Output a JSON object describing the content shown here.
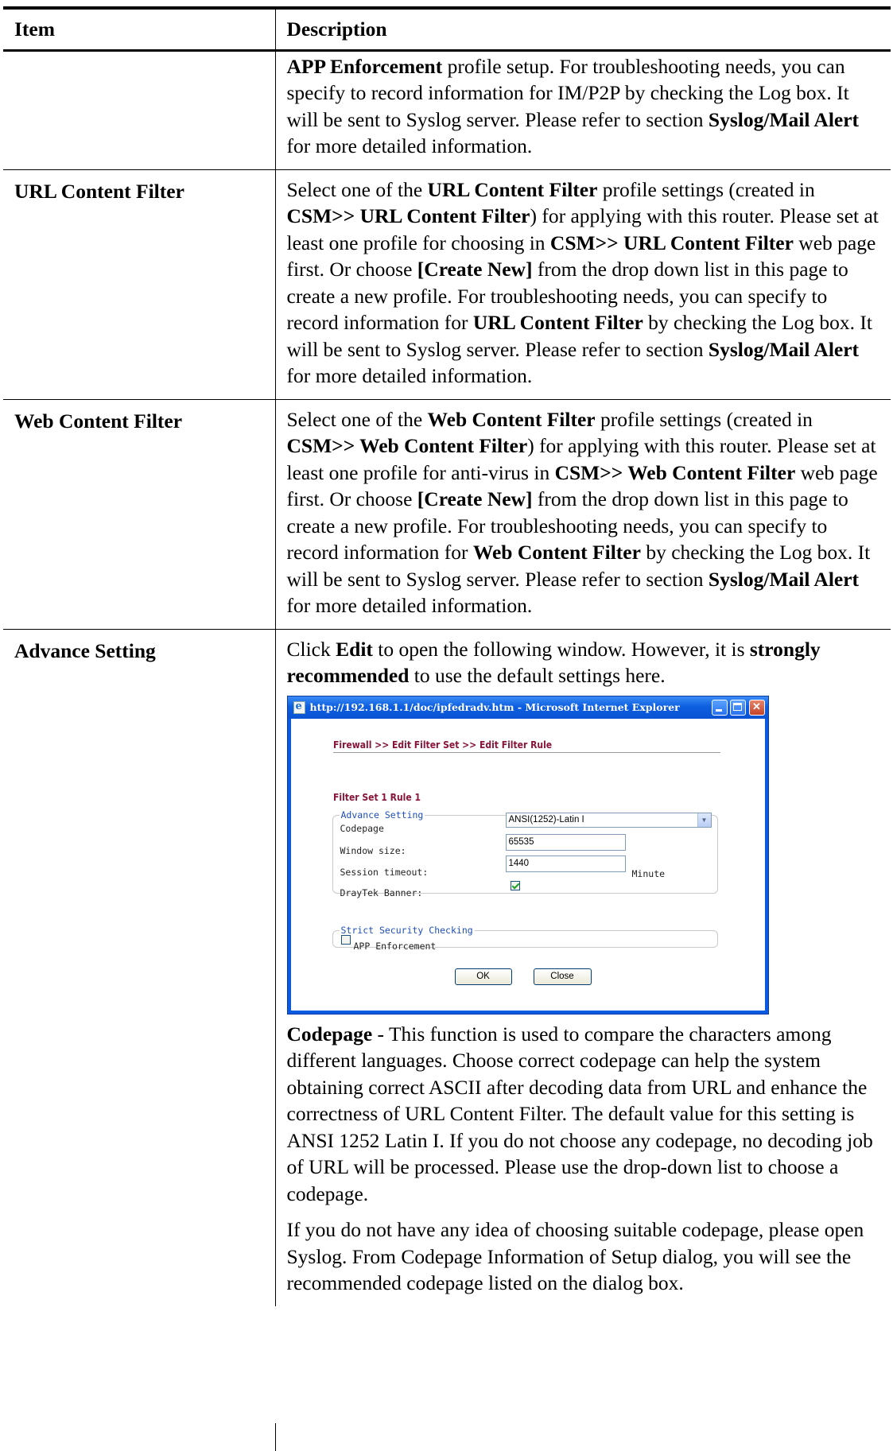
{
  "table": {
    "header_item": "Item",
    "header_description": "Description"
  },
  "rows": {
    "app": {
      "p1_b1": "APP Enforcement",
      "p1_t1": " profile setup. For troubleshooting needs, you can specify to record information for IM/P2P by checking the Log box. It will be sent to Syslog server. Please refer to section ",
      "p1_b2": "Syslog/Mail Alert",
      "p1_t2": " for more detailed information."
    },
    "url": {
      "item": "URL Content Filter",
      "t1": "Select one of the ",
      "b1": "URL Content Filter",
      "t2": " profile settings (created in ",
      "b2": "CSM>> URL Content Filter",
      "t3": ") for applying with this router. Please set at least one profile for choosing in ",
      "b3": "CSM>> URL Content Filter",
      "t4": " web page first. Or choose ",
      "b4": "[Create New]",
      "t5": " from the drop down list in this page to create a new profile. For troubleshooting needs, you can specify to record information for ",
      "b5": "URL Content Filter",
      "t6": " by checking the Log box. It will be sent to Syslog server. Please refer to section ",
      "b6": "Syslog/Mail Alert",
      "t7": " for more detailed information."
    },
    "web": {
      "item": "Web Content Filter",
      "t1": "Select one of the ",
      "b1": "Web Content Filter",
      "t2": " profile settings (created in ",
      "b2": "CSM>> Web Content Filter",
      "t3": ") for applying with this router. Please set at least one profile for anti-virus in ",
      "b3": "CSM>> Web Content Filter",
      "t4": " web page first. Or choose ",
      "b4": "[Create New]",
      "t5": " from the drop down list in this page to create a new profile. For troubleshooting needs, you can specify to record information for ",
      "b5": "Web Content Filter",
      "t6": " by checking the Log box. It will be sent to Syslog server. Please refer to section ",
      "b6": "Syslog/Mail Alert",
      "t7": " for more detailed information."
    },
    "adv": {
      "item": "Advance Setting",
      "intro_t1": "Click ",
      "intro_b1": "Edit",
      "intro_t2": " to open the following window. However, it is ",
      "intro_b2": "strongly recommended",
      "intro_t3": " to use the default settings here.",
      "codepage_b": "Codepage",
      "codepage_t": " - This function is used to compare the characters among different languages. Choose correct codepage can help the system obtaining correct ASCII after decoding data from URL and enhance the correctness of URL Content Filter. The default value for this setting is ANSI 1252 Latin I. If you do not choose any codepage, no decoding job of URL will be processed. Please use the drop-down list to choose a codepage.",
      "last_para": "If you do not have any idea of choosing suitable codepage, please open Syslog. From Codepage Information of Setup dialog, you will see the recommended codepage listed on the dialog box."
    }
  },
  "dialog": {
    "window_title": "http://192.168.1.1/doc/ipfedradv.htm - Microsoft Internet Explorer",
    "breadcrumb": "Firewall >> Edit Filter Set >> Edit Filter Rule",
    "rule_title": "Filter Set 1 Rule 1",
    "advance_legend": "Advance Setting",
    "codepage_label": "Codepage",
    "codepage_value": "ANSI(1252)-Latin I",
    "window_size_label": "Window size:",
    "window_size_value": "65535",
    "session_timeout_label": "Session timeout:",
    "session_timeout_value": "1440",
    "session_timeout_unit": "Minute",
    "banner_label": "DrayTek Banner:",
    "banner_checked": true,
    "strict_legend": "Strict Security Checking",
    "app_enforcement_label": "APP Enforcement",
    "app_enforcement_checked": false,
    "ok_label": "OK",
    "close_label": "Close",
    "colors": {
      "title_bar": "#0a5ae2",
      "heading_text": "#8a1538",
      "legend_text": "#1f4fb8"
    }
  }
}
